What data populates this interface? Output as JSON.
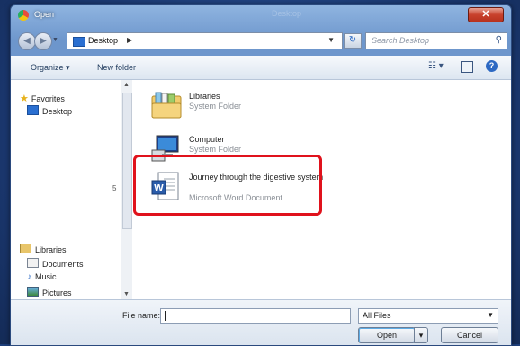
{
  "window": {
    "title": "Open",
    "ghost_title": "Desktop"
  },
  "address": {
    "path": "Desktop",
    "search_placeholder": "Search Desktop"
  },
  "toolbar": {
    "organize": "Organize ▾",
    "new_folder": "New folder"
  },
  "nav": {
    "favorites": "Favorites",
    "desktop": "Desktop",
    "libraries": "Libraries",
    "documents": "Documents",
    "music": "Music",
    "pictures": "Pictures",
    "stray_char": "5"
  },
  "files": [
    {
      "name": "Libraries",
      "type": "System Folder"
    },
    {
      "name": "Computer",
      "type": "System Folder"
    },
    {
      "name": "Journey through the digestive system",
      "type": "Microsoft Word Document"
    }
  ],
  "footer": {
    "file_name_label": "File name:",
    "file_name_value": "",
    "filter": "All Files",
    "open": "Open",
    "cancel": "Cancel"
  },
  "colors": {
    "highlight": "#e0121c",
    "accent": "#2d69c3"
  }
}
